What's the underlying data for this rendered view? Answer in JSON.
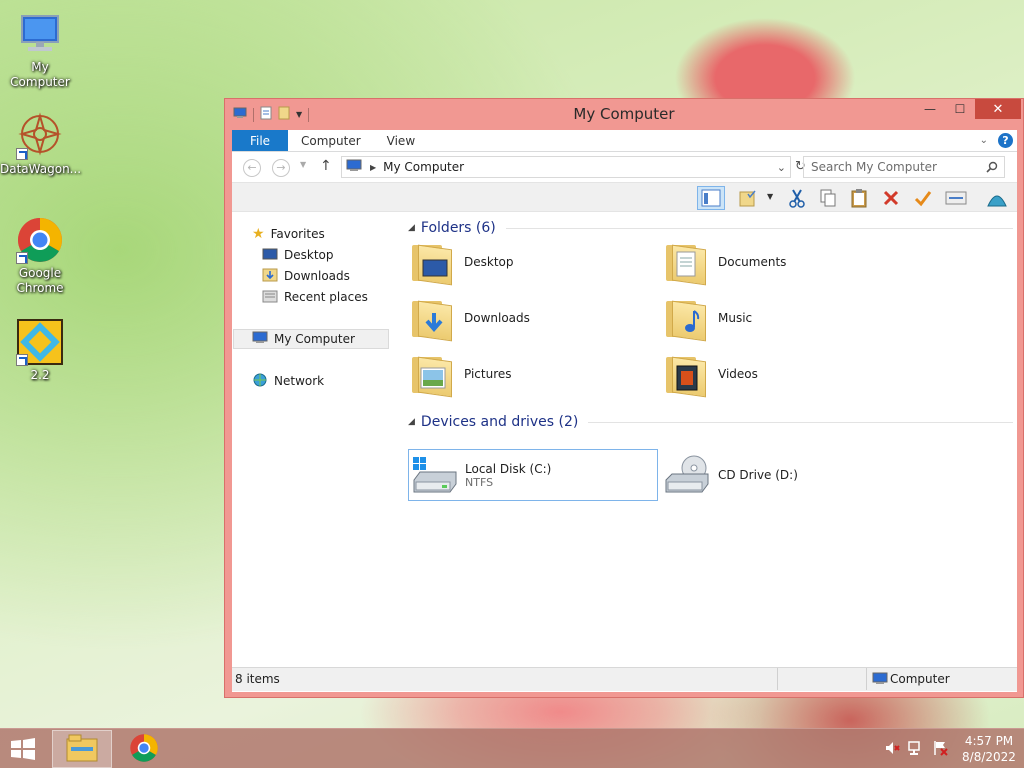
{
  "desktop": {
    "icons": [
      {
        "label": "My Computer"
      },
      {
        "label": "DataWagon..."
      },
      {
        "label": "Google Chrome"
      },
      {
        "label": "2.2"
      }
    ]
  },
  "window": {
    "title": "My Computer",
    "minimize_glyph": "—",
    "maximize_glyph": "☐",
    "close_glyph": "✕"
  },
  "ribbon": {
    "tabs": [
      "File",
      "Computer",
      "View"
    ],
    "help_glyph": "?"
  },
  "address": {
    "back_glyph": "←",
    "forward_glyph": "→",
    "up_glyph": "↑",
    "path": "My Computer",
    "search_placeholder": "Search My Computer"
  },
  "navigation": {
    "favorites": "Favorites",
    "desktop": "Desktop",
    "downloads": "Downloads",
    "recent": "Recent places",
    "computer": "My Computer",
    "network": "Network"
  },
  "content": {
    "folders_header": "Folders (6)",
    "folders": [
      "Desktop",
      "Documents",
      "Downloads",
      "Music",
      "Pictures",
      "Videos"
    ],
    "drives_header": "Devices and drives (2)",
    "drives": [
      {
        "name": "Local Disk (C:)",
        "fs": "NTFS"
      },
      {
        "name": "CD Drive (D:)"
      }
    ]
  },
  "status": {
    "inner_count": "8 items",
    "bar_count": "8 items",
    "bar_location": "Computer"
  },
  "taskbar": {
    "clock_time": "4:57 PM",
    "clock_date": "8/8/2022"
  },
  "colors": {
    "window_frame": "#f19892",
    "file_tab": "#1979ca",
    "group_header": "#1e3287",
    "close_button": "#c84a3e"
  }
}
